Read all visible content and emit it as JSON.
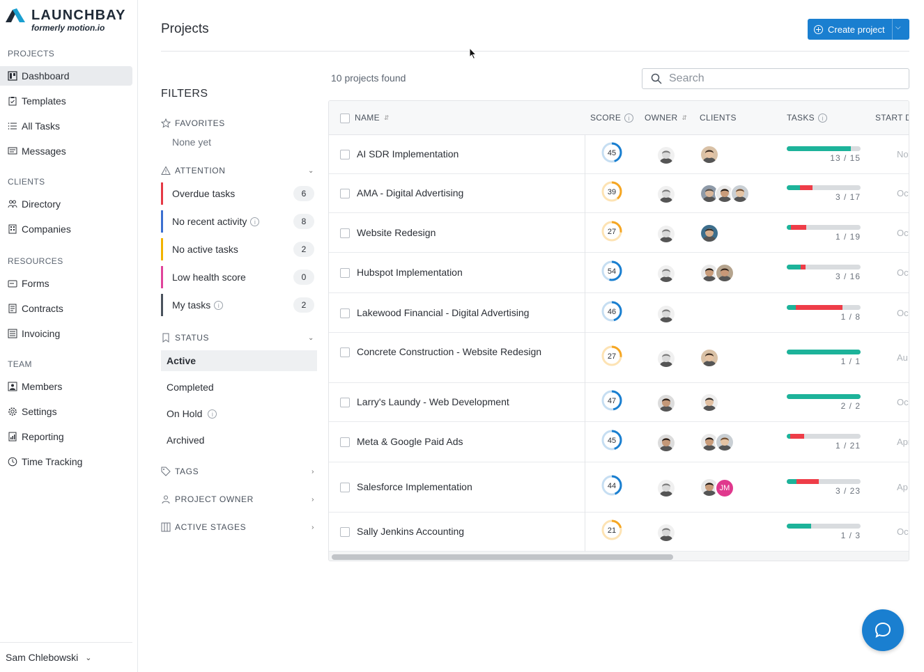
{
  "app": {
    "brand": "LAUNCHBAY",
    "tagline": "formerly motion.io"
  },
  "sidebar": {
    "sections": [
      {
        "title": "PROJECTS",
        "items": [
          {
            "label": "Dashboard",
            "icon": "dashboard-icon",
            "active": true
          },
          {
            "label": "Templates",
            "icon": "clipboard-icon"
          },
          {
            "label": "All Tasks",
            "icon": "list-icon"
          },
          {
            "label": "Messages",
            "icon": "message-icon"
          }
        ]
      },
      {
        "title": "CLIENTS",
        "items": [
          {
            "label": "Directory",
            "icon": "users-icon"
          },
          {
            "label": "Companies",
            "icon": "building-icon"
          }
        ]
      },
      {
        "title": "RESOURCES",
        "items": [
          {
            "label": "Forms",
            "icon": "form-icon"
          },
          {
            "label": "Contracts",
            "icon": "document-icon"
          },
          {
            "label": "Invoicing",
            "icon": "invoice-icon"
          }
        ]
      },
      {
        "title": "TEAM",
        "items": [
          {
            "label": "Members",
            "icon": "member-icon"
          },
          {
            "label": "Settings",
            "icon": "gear-icon"
          },
          {
            "label": "Reporting",
            "icon": "report-icon"
          },
          {
            "label": "Time Tracking",
            "icon": "clock-icon"
          }
        ]
      }
    ],
    "user": "Sam Chlebowski"
  },
  "header": {
    "title": "Projects",
    "create_label": "Create project"
  },
  "filters": {
    "title": "FILTERS",
    "favorites": {
      "label": "FAVORITES",
      "empty": "None yet"
    },
    "attention": {
      "label": "ATTENTION",
      "items": [
        {
          "label": "Overdue tasks",
          "count": "6",
          "color": "#e53945",
          "info": false
        },
        {
          "label": "No recent activity",
          "count": "8",
          "color": "#3b6fd1",
          "info": true
        },
        {
          "label": "No active tasks",
          "count": "2",
          "color": "#f2b300",
          "info": false
        },
        {
          "label": "Low health score",
          "count": "0",
          "color": "#e0439a",
          "info": false
        },
        {
          "label": "My tasks",
          "count": "2",
          "color": "#4a525d",
          "info": true
        }
      ]
    },
    "status": {
      "label": "STATUS",
      "items": [
        {
          "label": "Active",
          "active": true
        },
        {
          "label": "Completed"
        },
        {
          "label": "On Hold",
          "info": true
        },
        {
          "label": "Archived"
        }
      ]
    },
    "tags": "TAGS",
    "project_owner": "PROJECT OWNER",
    "active_stages": "ACTIVE STAGES"
  },
  "results": {
    "count_text": "10 projects found",
    "search_placeholder": "Search"
  },
  "table": {
    "columns": {
      "name": "NAME",
      "score": "SCORE",
      "owner": "OWNER",
      "clients": "CLIENTS",
      "tasks": "TASKS",
      "start": "START D."
    },
    "rows": [
      {
        "name": "AI SDR Implementation",
        "score": 45,
        "score_color": "#1a7fd0",
        "owner": "m",
        "clients": [
          "c1"
        ],
        "done": 13,
        "total": 15,
        "overdue": 0,
        "tasks": "13 / 15",
        "start": "Nov"
      },
      {
        "name": "AMA - Digital Advertising",
        "score": 39,
        "score_color": "#f5a623",
        "owner": "m",
        "clients": [
          "c2",
          "c3",
          "c4"
        ],
        "done": 3,
        "total": 17,
        "overdue": 3,
        "tasks": "3 / 17",
        "start": "Oct"
      },
      {
        "name": "Website Redesign",
        "score": 27,
        "score_color": "#f5a623",
        "owner": "m",
        "clients": [
          "c5"
        ],
        "done": 1,
        "total": 19,
        "overdue": 4,
        "tasks": "1 / 19",
        "start": "Oct"
      },
      {
        "name": "Hubspot Implementation",
        "score": 54,
        "score_color": "#1a7fd0",
        "owner": "m",
        "clients": [
          "c3",
          "c6"
        ],
        "done": 3,
        "total": 16,
        "overdue": 1,
        "tasks": "3 / 16",
        "start": "Oct"
      },
      {
        "name": "Lakewood Financial - Digital Advertising",
        "score": 46,
        "score_color": "#1a7fd0",
        "owner": "m",
        "clients": [],
        "done": 1,
        "total": 8,
        "overdue": 5,
        "tasks": "1 / 8",
        "start": "Oc"
      },
      {
        "name": "Concrete Construction - Website Redesign",
        "score": 27,
        "score_color": "#f5a623",
        "owner": "m",
        "clients": [
          "c1"
        ],
        "done": 1,
        "total": 1,
        "overdue": 0,
        "tasks": "1 / 1",
        "start": "Au"
      },
      {
        "name": "Larry's Laundy - Web Development",
        "score": 47,
        "score_color": "#1a7fd0",
        "owner": "f",
        "clients": [
          "c7"
        ],
        "done": 2,
        "total": 2,
        "overdue": 0,
        "tasks": "2 / 2",
        "start": "Oc"
      },
      {
        "name": "Meta & Google Paid Ads",
        "score": 45,
        "score_color": "#1a7fd0",
        "owner": "f",
        "clients": [
          "c3",
          "c4"
        ],
        "done": 1,
        "total": 21,
        "overdue": 4,
        "tasks": "1 / 21",
        "start": "Apr"
      },
      {
        "name": "Salesforce Implementation",
        "score": 44,
        "score_color": "#1a7fd0",
        "owner": "m",
        "clients": [
          "c3",
          "JM"
        ],
        "done": 3,
        "total": 23,
        "overdue": 7,
        "tasks": "3 / 23",
        "start": "Ap"
      },
      {
        "name": "Sally Jenkins Accounting",
        "score": 21,
        "score_color": "#f5a623",
        "owner": "m",
        "clients": [],
        "done": 1,
        "total": 3,
        "overdue": 0,
        "tasks": "1 / 3",
        "start": "Oc"
      }
    ]
  }
}
